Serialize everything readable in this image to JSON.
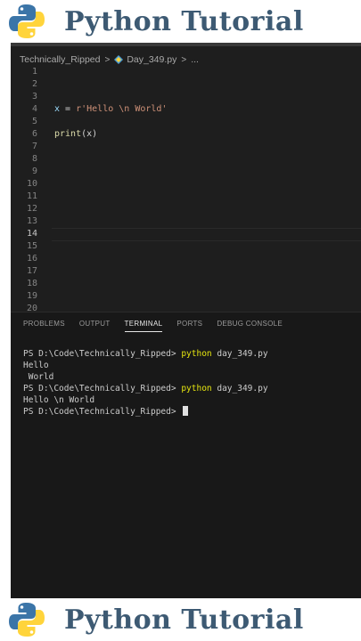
{
  "banner": {
    "title": "Python Tutorial",
    "logo_icon": "python-logo-icon",
    "colors": {
      "logo_blue": "#3b75a8",
      "logo_yellow": "#ffd43b",
      "title": "#3d5a73"
    }
  },
  "breadcrumb": {
    "folder": "Technically_Ripped",
    "separator": ">",
    "file_icon": "python-file-icon",
    "file": "Day_349.py",
    "trail": "..."
  },
  "editor": {
    "current_line": 14,
    "lines": [
      {
        "num": "1"
      },
      {
        "num": "2"
      },
      {
        "num": "3"
      },
      {
        "num": "4",
        "tokens": {
          "var": "x",
          "op": " = ",
          "str": "r'Hello \\n World'"
        }
      },
      {
        "num": "5"
      },
      {
        "num": "6",
        "tokens": {
          "fn": "print",
          "rest": "(x)"
        }
      },
      {
        "num": "7"
      },
      {
        "num": "8"
      },
      {
        "num": "9"
      },
      {
        "num": "10"
      },
      {
        "num": "11"
      },
      {
        "num": "12"
      },
      {
        "num": "13"
      },
      {
        "num": "14"
      },
      {
        "num": "15"
      },
      {
        "num": "16"
      },
      {
        "num": "17"
      },
      {
        "num": "18"
      },
      {
        "num": "19"
      },
      {
        "num": "20"
      }
    ]
  },
  "panel": {
    "tabs": [
      {
        "label": "PROBLEMS",
        "active": false
      },
      {
        "label": "OUTPUT",
        "active": false
      },
      {
        "label": "TERMINAL",
        "active": true
      },
      {
        "label": "PORTS",
        "active": false
      },
      {
        "label": "DEBUG CONSOLE",
        "active": false
      }
    ],
    "terminal": {
      "prompt": "PS D:\\Code\\Technically_Ripped> ",
      "cmd_word": "python",
      "cmd_arg": " day_349.py",
      "output1": "Hello",
      "output2": " World",
      "output3": "Hello \\n World"
    }
  },
  "colors": {
    "editor_bg": "#1e1e1e",
    "panel_bg": "#181818",
    "string": "#ce9178",
    "variable": "#9cdcfe",
    "function": "#dcdcaa",
    "terminal_cmd": "#e5e510"
  }
}
